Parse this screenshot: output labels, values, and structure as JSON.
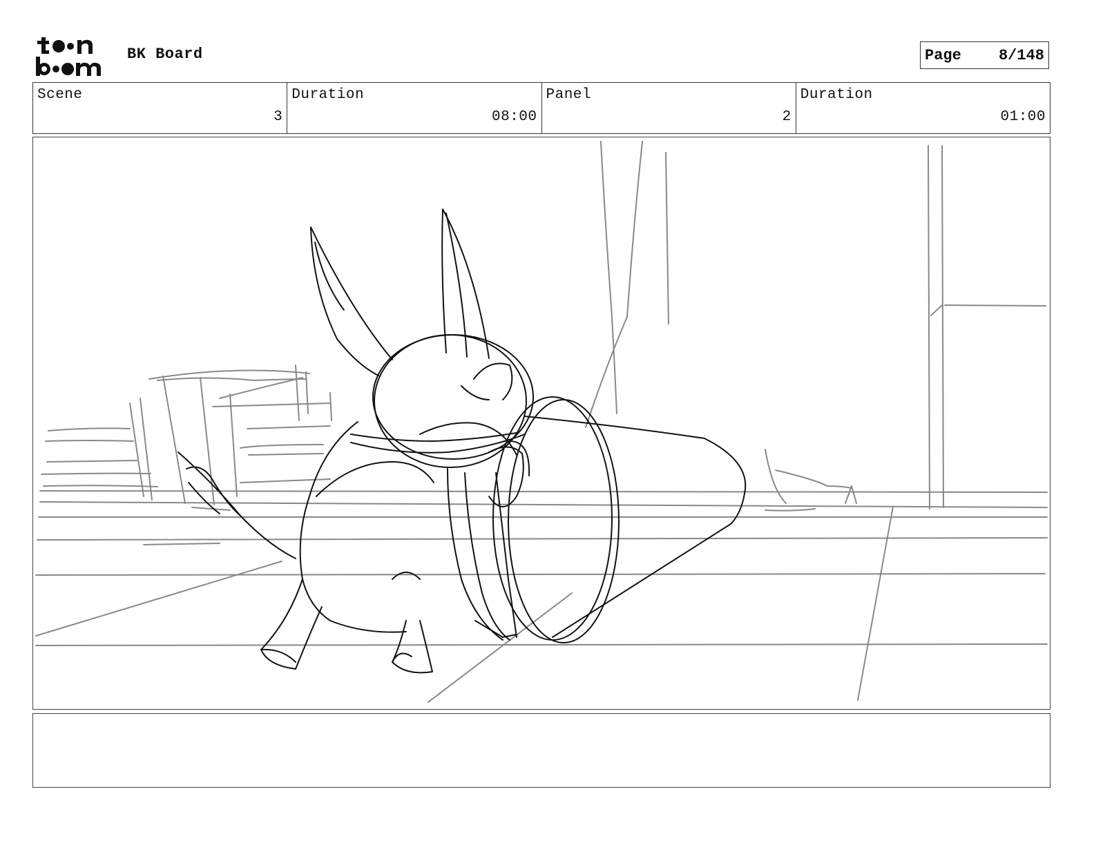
{
  "header": {
    "logo_text": [
      "to",
      "on",
      "bo",
      "om"
    ],
    "project_title": "BK Board",
    "page_label": "Page",
    "page_value": "8/148"
  },
  "info": {
    "scene_label": "Scene",
    "scene_value": "3",
    "scene_duration_label": "Duration",
    "scene_duration_value": "08:00",
    "panel_label": "Panel",
    "panel_value": "2",
    "panel_duration_label": "Duration",
    "panel_duration_value": "01:00"
  },
  "caption": {
    "text": ""
  }
}
